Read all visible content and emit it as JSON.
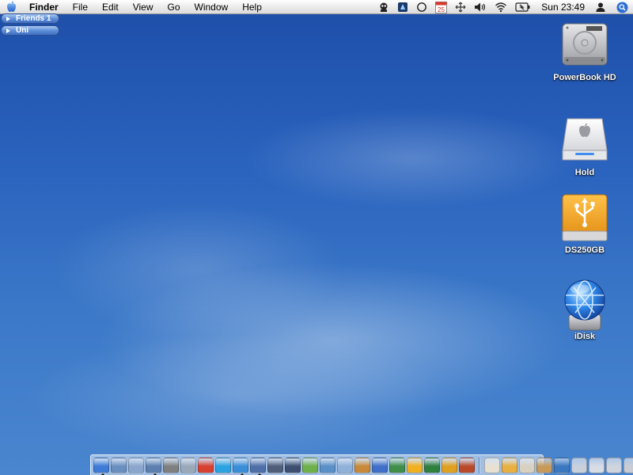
{
  "menubar": {
    "apple_icon": "apple-icon",
    "items": [
      "Finder",
      "File",
      "Edit",
      "View",
      "Go",
      "Window",
      "Help"
    ],
    "extras": {
      "calendar_day": "25",
      "clock": "Sun 23:49"
    }
  },
  "drawers": [
    {
      "label": "Friends 1"
    },
    {
      "label": "Uni"
    }
  ],
  "desktop_icons": [
    {
      "label": "PowerBook HD",
      "icon": "hard-drive-icon"
    },
    {
      "label": "Hold",
      "icon": "external-drive-icon"
    },
    {
      "label": "DS250GB",
      "icon": "usb-drive-icon"
    },
    {
      "label": "iDisk",
      "icon": "idisk-icon"
    }
  ],
  "dock": {
    "apps": [
      {
        "icon": "finder-icon",
        "running": true,
        "color": "#3d7bd6"
      },
      {
        "icon": "mail-icon",
        "running": false,
        "color": "#6a8fbf"
      },
      {
        "icon": "textedit-icon",
        "running": false,
        "color": "#8aa6cc"
      },
      {
        "icon": "preview-icon",
        "running": true,
        "color": "#5c7fb0"
      },
      {
        "icon": "system-preferences-icon",
        "running": false,
        "color": "#7f7f7f"
      },
      {
        "icon": "network-icon",
        "running": false,
        "color": "#9aa8b8"
      },
      {
        "icon": "ical-icon",
        "running": false,
        "color": "#d84030"
      },
      {
        "icon": "skype-icon",
        "running": false,
        "color": "#2aa3e0"
      },
      {
        "icon": "safari-icon",
        "running": true,
        "color": "#3a8ed8"
      },
      {
        "icon": "browser-icon",
        "running": true,
        "color": "#4f6fa8"
      },
      {
        "icon": "photo-icon",
        "running": false,
        "color": "#4f5f7a"
      },
      {
        "icon": "imovie-icon",
        "running": false,
        "color": "#3e4e6e"
      },
      {
        "icon": "itunes-icon",
        "running": false,
        "color": "#6fb04a"
      },
      {
        "icon": "iphoto-icon",
        "running": false,
        "color": "#5a8fc8"
      },
      {
        "icon": "network-utility-icon",
        "running": false,
        "color": "#8fb0d8"
      },
      {
        "icon": "garageband-icon",
        "running": false,
        "color": "#c88a3a"
      },
      {
        "icon": "word-icon",
        "running": false,
        "color": "#3f6fc8"
      },
      {
        "icon": "excel-icon",
        "running": false,
        "color": "#3f8f4a"
      },
      {
        "icon": "adium-icon",
        "running": false,
        "color": "#f0b020"
      },
      {
        "icon": "grapher-icon",
        "running": false,
        "color": "#2f7f3f"
      },
      {
        "icon": "chat-icon",
        "running": false,
        "color": "#e0a020"
      },
      {
        "icon": "flash-icon",
        "running": false,
        "color": "#b84a2a"
      }
    ],
    "docs": [
      {
        "icon": "document-icon",
        "color": "#e8e0d0"
      },
      {
        "icon": "folder-icon",
        "color": "#e8b040"
      },
      {
        "icon": "document-stack-icon",
        "color": "#d8d0c0"
      },
      {
        "icon": "package-icon",
        "color": "#c89a5a"
      },
      {
        "icon": "globe-icon",
        "color": "#3a78c0"
      },
      {
        "icon": "window-icon",
        "color": "#c8d0dc"
      },
      {
        "icon": "window-icon",
        "color": "#d8dce4"
      },
      {
        "icon": "window-icon",
        "color": "#d0d4dc"
      },
      {
        "icon": "window-icon",
        "color": "#c8ccd4"
      },
      {
        "icon": "trash-icon",
        "color": "#8a8a8a"
      }
    ]
  }
}
